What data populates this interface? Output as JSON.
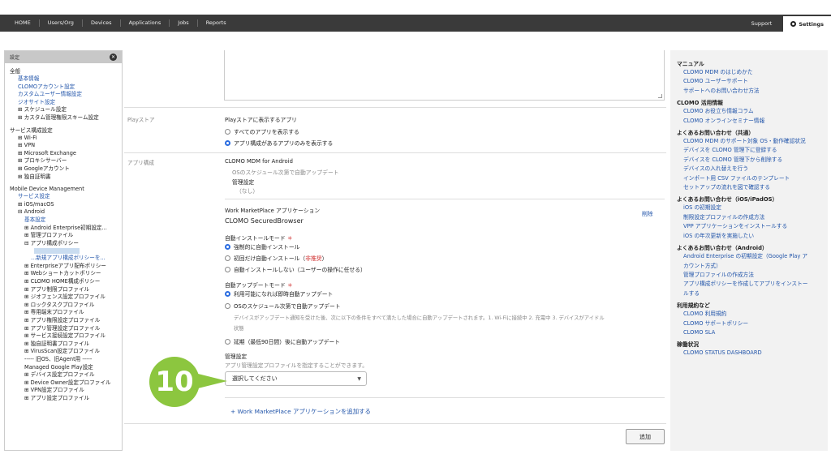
{
  "topnav": {
    "items": [
      "HOME",
      "Users/Org",
      "Devices",
      "Applications",
      "Jobs",
      "Reports"
    ],
    "support": "Support",
    "settings": "Settings"
  },
  "sidebar": {
    "header": "設定",
    "close_icon": "close-circle-icon",
    "entries": [
      {
        "text": "全般",
        "kind": "h",
        "lvl": 0
      },
      {
        "text": "基本情報",
        "kind": "link",
        "lvl": 1
      },
      {
        "text": "CLOMOアカウント設定",
        "kind": "link",
        "lvl": 1
      },
      {
        "text": "カスタムユーザー情報設定",
        "kind": "link",
        "lvl": 1
      },
      {
        "text": "ジオサイト設定",
        "kind": "link",
        "lvl": 1
      },
      {
        "text": "⊞ スケジュール設定",
        "kind": "item",
        "lvl": 1
      },
      {
        "text": "⊞ カスタム管理権限スキーム設定",
        "kind": "item",
        "lvl": 1
      },
      {
        "text": "サービス構成設定",
        "kind": "h",
        "lvl": 0
      },
      {
        "text": "⊞ Wi-Fi",
        "kind": "item",
        "lvl": 1
      },
      {
        "text": "⊞ VPN",
        "kind": "item",
        "lvl": 1
      },
      {
        "text": "⊞ Microsoft Exchange",
        "kind": "item",
        "lvl": 1
      },
      {
        "text": "⊞ プロキシサーバー",
        "kind": "item",
        "lvl": 1
      },
      {
        "text": "⊞ Googleアカウント",
        "kind": "item",
        "lvl": 1
      },
      {
        "text": "⊞ 独自証明書",
        "kind": "item",
        "lvl": 1
      },
      {
        "text": "Mobile Device Management",
        "kind": "h",
        "lvl": 0
      },
      {
        "text": "サービス設定",
        "kind": "link",
        "lvl": 1
      },
      {
        "text": "⊞ iOS/macOS",
        "kind": "item",
        "lvl": 1
      },
      {
        "text": "⊟ Android",
        "kind": "item",
        "lvl": 1
      },
      {
        "text": "基本設定",
        "kind": "link",
        "lvl": 2
      },
      {
        "text": "⊞ Android Enterprise初期設定...",
        "kind": "item",
        "lvl": 2
      },
      {
        "text": "⊞ 管理プロファイル",
        "kind": "item",
        "lvl": 2
      },
      {
        "text": "⊟ アプリ構成ポリシー",
        "kind": "item",
        "lvl": 2
      },
      {
        "text": "",
        "kind": "sel",
        "lvl": 3
      },
      {
        "text": "...新規アプリ構成ポリシーを...",
        "kind": "link",
        "lvl": 3
      },
      {
        "text": "⊞ Enterpriseアプリ配布ポリシー",
        "kind": "item",
        "lvl": 2
      },
      {
        "text": "⊞ Webショートカットポリシー",
        "kind": "item",
        "lvl": 2
      },
      {
        "text": "⊞ CLOMO HOME構成ポリシー",
        "kind": "item",
        "lvl": 2
      },
      {
        "text": "⊞ アプリ制限プロファイル",
        "kind": "item",
        "lvl": 2
      },
      {
        "text": "⊞ ジオフェンス設定プロファイル",
        "kind": "item",
        "lvl": 2
      },
      {
        "text": "⊞ ロックタスクプロファイル",
        "kind": "item",
        "lvl": 2
      },
      {
        "text": "⊞ 専用端末プロファイル",
        "kind": "item",
        "lvl": 2
      },
      {
        "text": "⊞ アプリ権限設定プロファイル",
        "kind": "item",
        "lvl": 2
      },
      {
        "text": "⊞ アプリ管理設定プロファイル",
        "kind": "item",
        "lvl": 2
      },
      {
        "text": "⊞ サービス接続設定プロファイル",
        "kind": "item",
        "lvl": 2
      },
      {
        "text": "⊞ 独自証明書プロファイル",
        "kind": "item",
        "lvl": 2
      },
      {
        "text": "⊞ VirusScan設定プロファイル",
        "kind": "item",
        "lvl": 2
      },
      {
        "text": "----- 旧OS、旧Agent用 -----",
        "kind": "item",
        "lvl": 2
      },
      {
        "text": "Managed Google Play設定",
        "kind": "item",
        "lvl": 2
      },
      {
        "text": "⊞ デバイス設定プロファイル",
        "kind": "item",
        "lvl": 2
      },
      {
        "text": "⊞ Device Owner設定プロファイル",
        "kind": "item",
        "lvl": 2
      },
      {
        "text": "⊞ VPN設定プロファイル",
        "kind": "item",
        "lvl": 2
      },
      {
        "text": "⊞ アプリ設定プロファイル",
        "kind": "item",
        "lvl": 2
      }
    ]
  },
  "main": {
    "play_label": "Playストア",
    "play_title": "Playストアに表示するアプリ",
    "play_opt1": "すべてのアプリを表示する",
    "play_opt2": "アプリ構成があるアプリのみを表示する",
    "app_label": "アプリ構成",
    "app_name": "CLOMO MDM for Android",
    "app_sched": "OSのスケジュール次第で自動アップデート",
    "mgmt_label": "管理設定",
    "mgmt_none": "（なし）",
    "wm_title": "Work MarketPlace アプリケーション",
    "wm_app": "CLOMO SecuredBrowser",
    "delete": "削除",
    "auto_install_title": "自動インストールモード",
    "required_mark": "＊",
    "ai_opt1": "強制的に自動インストール",
    "ai_opt2": "初回だけ自動インストール（",
    "ai_opt2_red": "非推奨",
    "ai_opt2_end": "）",
    "ai_opt3": "自動インストールしない（ユーザーの操作に任せる）",
    "auto_update_title": "自動アップデートモード",
    "au_opt1": "利用可能になれば即時自動アップデート",
    "au_opt2": "OSのスケジュール次第で自動アップデート",
    "au_desc1": "デバイスがアップデート通知を受けた後、次に以下の条件をすべて満たした場合に自動アップデートされます。1. Wi-Fiに接続中 2. 充電中 3. デバイスがアイドル",
    "au_desc2": "状態",
    "au_opt3": "延期（最低90日間）後に自動アップデート",
    "mgmt2_label": "管理設定",
    "mgmt2_desc": "アプリ管理設定プロファイルを指定することができます。",
    "select_value": "選択してください",
    "add_link": "+ Work MarketPlace アプリケーションを追加する",
    "add_button": "追加",
    "badge": "10"
  },
  "right": {
    "sections": [
      {
        "title": "マニュアル",
        "links": [
          "CLOMO MDM のはじめかた",
          "CLOMO ユーザーサポート",
          "サポートへのお問い合わせ方法"
        ]
      },
      {
        "title": "CLOMO 活用情報",
        "links": [
          "CLOMO お役立ち情報コラム",
          "CLOMO オンラインセミナー情報"
        ]
      },
      {
        "title": "よくあるお問い合わせ（共通）",
        "links": [
          "CLOMO MDM のサポート対象 OS・動作確認状況",
          "デバイスを CLOMO 管理下に登録する",
          "デバイスを CLOMO 管理下から削除する",
          "デバイスの入れ替えを行う",
          "インポート用 CSV ファイルのテンプレート",
          "セットアップの流れを図で確認する"
        ]
      },
      {
        "title": "よくあるお問い合わせ（iOS/iPadOS）",
        "links": [
          "iOS の初期設定",
          "制限設定プロファイルの作成方法",
          "VPP アプリケーションをインストールする",
          "iOS の年次更新を実施したい"
        ]
      },
      {
        "title": "よくあるお問い合わせ（Android）",
        "links": [
          "Android Enterprise の初期設定（Google Play ア",
          "カウント方式）",
          "管理プロファイルの作成方法",
          "アプリ構成ポリシーを作成してアプリをインストー",
          "ルする"
        ]
      },
      {
        "title": "利用規約など",
        "links": [
          "CLOMO 利用規約",
          "CLOMO サポートポリシー",
          "CLOMO SLA"
        ]
      },
      {
        "title": "稼働状況",
        "links": [
          "CLOMO STATUS DASHBOARD"
        ]
      }
    ]
  }
}
